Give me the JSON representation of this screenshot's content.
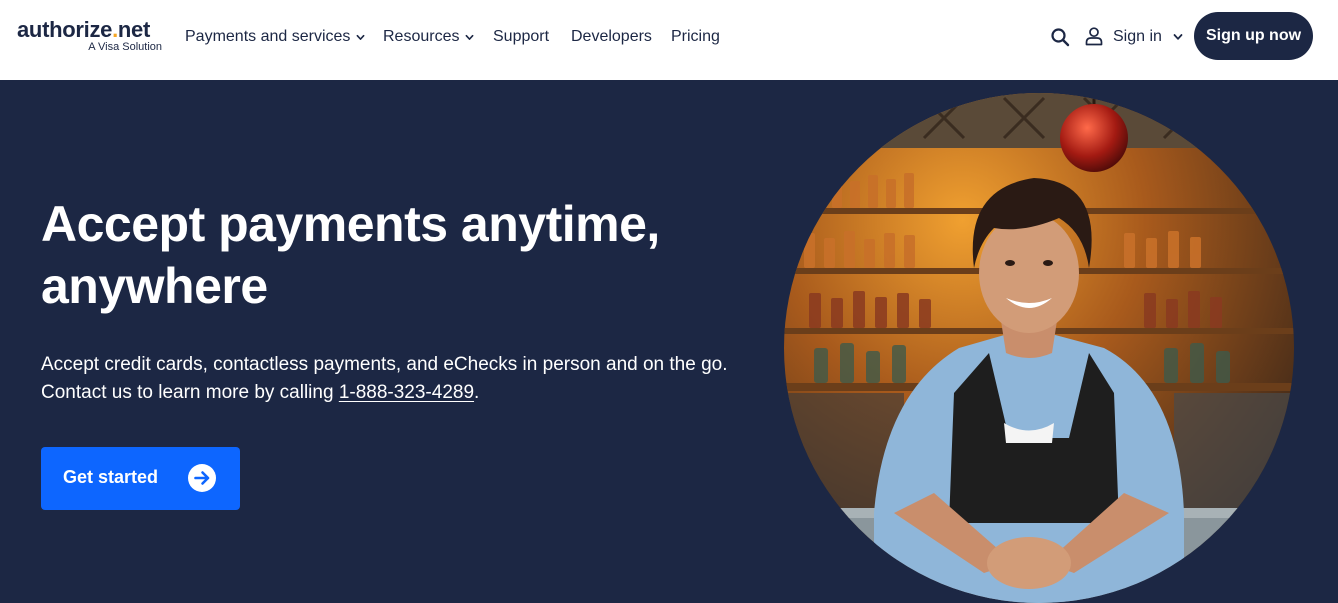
{
  "header": {
    "logo": {
      "name": "authorize",
      "dot": ".",
      "tld": "net",
      "tagline": "A Visa Solution"
    },
    "nav": [
      {
        "label": "Payments and services",
        "has_dropdown": true
      },
      {
        "label": "Resources",
        "has_dropdown": true
      },
      {
        "label": "Support",
        "has_dropdown": false
      },
      {
        "label": "Developers",
        "has_dropdown": false
      },
      {
        "label": "Pricing",
        "has_dropdown": false
      }
    ],
    "icons": {
      "search": "search-icon",
      "user": "user-icon"
    },
    "signin_label": "Sign in",
    "signup_label": "Sign up now"
  },
  "hero": {
    "headline_line1": "Accept payments anytime,",
    "headline_line2": "anywhere",
    "subtext": "Accept credit cards, contactless payments, and eChecks in person and on the go. Contact us to learn more by calling ",
    "phone": "1-888-323-4289",
    "subtext_end": ".",
    "cta_label": "Get started",
    "cta_icon": "arrow-right-circle-icon",
    "image": "smiling-bartender-photo"
  },
  "colors": {
    "navy": "#1c2744",
    "accent_blue": "#0d66ff",
    "logo_dot": "#f5a623",
    "white": "#ffffff"
  }
}
